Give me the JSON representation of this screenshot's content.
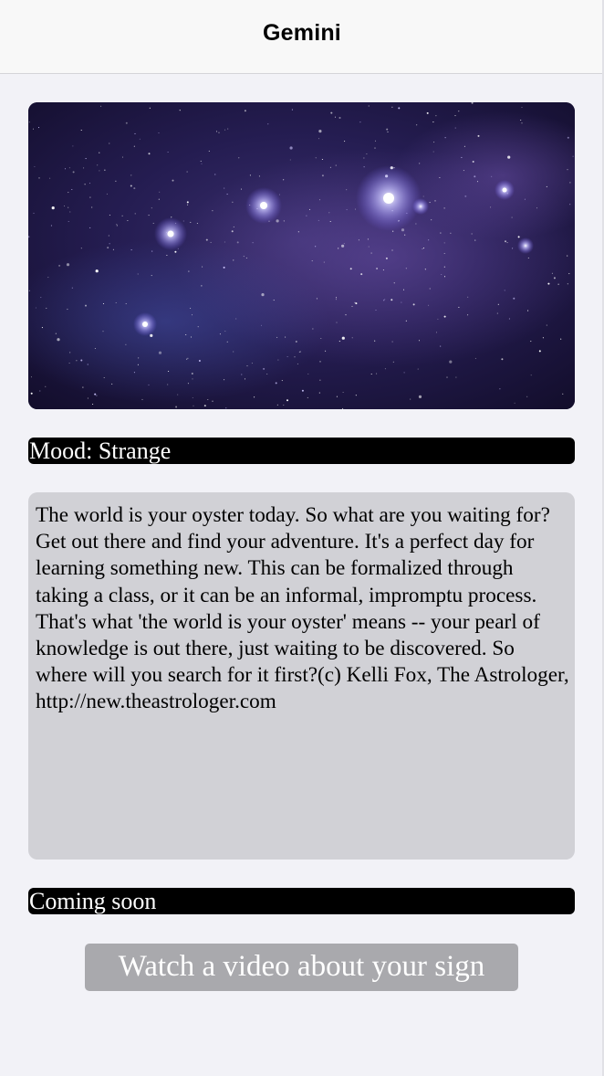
{
  "nav": {
    "title": "Gemini"
  },
  "hero": {
    "image": "starry-night-sky"
  },
  "mood": {
    "label": "Mood: Strange"
  },
  "horoscope": {
    "text": "The world is your oyster today. So what are you waiting for? Get out there and find your adventure. It's a perfect day for learning something new. This can be formalized through taking a class, or it can be an informal, impromptu process. That's what 'the world is your oyster' means -- your pearl of knowledge is out there, just waiting to be discovered. So where will you search for it first?(c) Kelli Fox, The Astrologer, http://new.theastrologer.com"
  },
  "coming_soon": {
    "label": "Coming soon"
  },
  "video_button": {
    "label": "Watch a video about your sign"
  },
  "colors": {
    "background": "#f2f2f7",
    "label_bar": "#000000",
    "text_panel": "#d1d1d6",
    "button": "#a9a9ad",
    "sky": "#1b1538"
  }
}
